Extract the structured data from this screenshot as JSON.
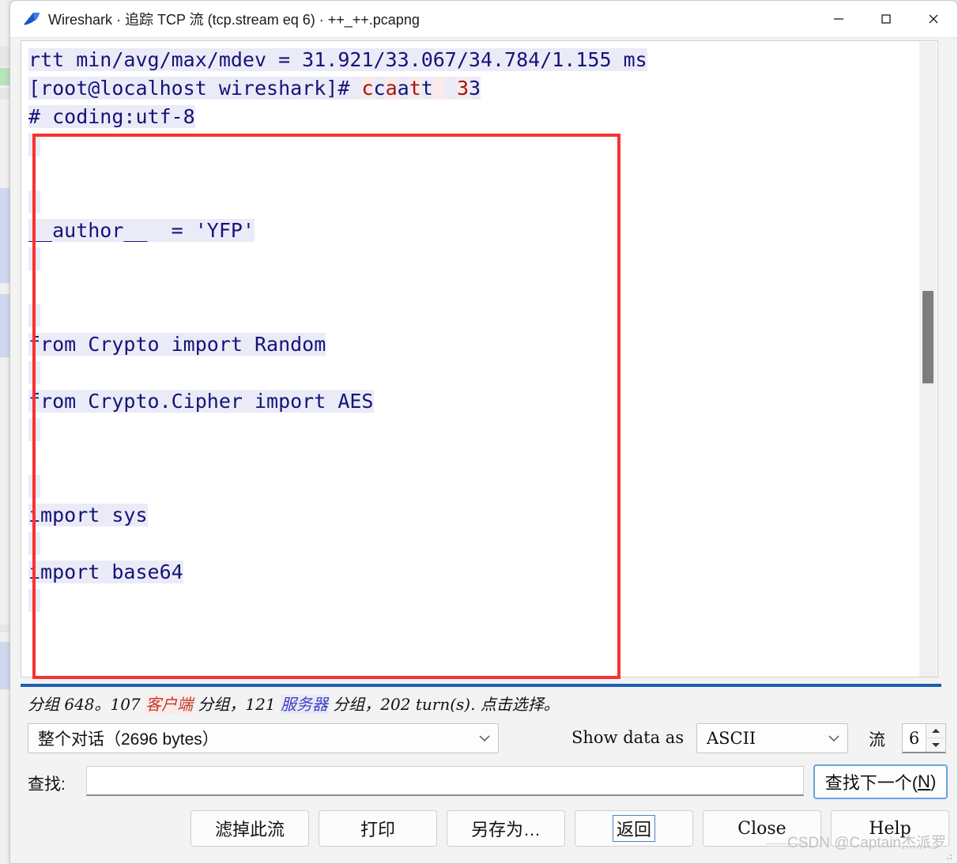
{
  "window": {
    "title": "Wireshark · 追踪 TCP 流 (tcp.stream eq 6) · ++_++.pcapng",
    "icon": "wireshark-fin-icon",
    "minimize_label": "minimize-icon",
    "maximize_label": "maximize-icon",
    "close_label": "close-icon"
  },
  "stream": {
    "lines": [
      {
        "id": "l1",
        "role": "server",
        "text": "rtt min/avg/max/mdev = 31.921/33.067/34.784/1.155 ms"
      },
      {
        "id": "l2",
        "role": "mixed",
        "prefix": "[root@localhost wireshark]# ",
        "echo": "ccaatt  33"
      },
      {
        "id": "l3",
        "role": "server",
        "text": "# coding:utf-8"
      },
      {
        "id": "l4",
        "role": "server",
        "text": "·"
      },
      {
        "id": "l5",
        "role": "server",
        "text": ""
      },
      {
        "id": "l6",
        "role": "server",
        "text": "·"
      },
      {
        "id": "l7",
        "role": "server",
        "text": "__author__  = 'YFP'"
      },
      {
        "id": "l8",
        "role": "server",
        "text": "·"
      },
      {
        "id": "l9",
        "role": "server",
        "text": ""
      },
      {
        "id": "l10",
        "role": "server",
        "text": "·"
      },
      {
        "id": "l11",
        "role": "server",
        "text": "from Crypto import Random"
      },
      {
        "id": "l12",
        "role": "server",
        "text": "·"
      },
      {
        "id": "l13",
        "role": "server",
        "text": "from Crypto.Cipher import AES"
      },
      {
        "id": "l14",
        "role": "server",
        "text": "·"
      },
      {
        "id": "l15",
        "role": "server",
        "text": ""
      },
      {
        "id": "l16",
        "role": "server",
        "text": "·"
      },
      {
        "id": "l17",
        "role": "server",
        "text": "import sys"
      },
      {
        "id": "l18",
        "role": "server",
        "text": "·"
      },
      {
        "id": "l19",
        "role": "server",
        "text": "import base64"
      },
      {
        "id": "l20",
        "role": "server",
        "text": "·"
      }
    ],
    "colors": {
      "server_text": "#14147a",
      "server_bg": "#ebebf7",
      "client_text": "#9e1616",
      "client_bg": "#fbeaea",
      "annotation_box": "#f6332f",
      "separator": "#1a5fb4"
    }
  },
  "status": {
    "prefix": "分组 648。107 ",
    "client_word": "客户端",
    "mid": " 分组，121 ",
    "server_word": "服务器",
    "suffix": " 分组，202 turn(s). 点击选择。"
  },
  "controls": {
    "conversation_value": "整个对话（2696 bytes）",
    "show_data_as_label": "Show data as",
    "show_data_as_value": "ASCII",
    "stream_label": "流",
    "stream_value": "6",
    "chevron_icon": "chevron-down-icon",
    "spinner_up_icon": "spinner-up-icon",
    "spinner_down_icon": "spinner-down-icon"
  },
  "find": {
    "label": "查找:",
    "value": "",
    "placeholder": "",
    "find_next_text": "查找下一个(",
    "find_next_accel": "N",
    "find_next_tail": ")"
  },
  "buttons": {
    "filter_out": "滤掉此流",
    "print": "打印",
    "save_as": "另存为…",
    "back": "返回",
    "close": "Close",
    "help": "Help"
  },
  "watermark": {
    "text": "CSDN @Captain杰派罗"
  }
}
